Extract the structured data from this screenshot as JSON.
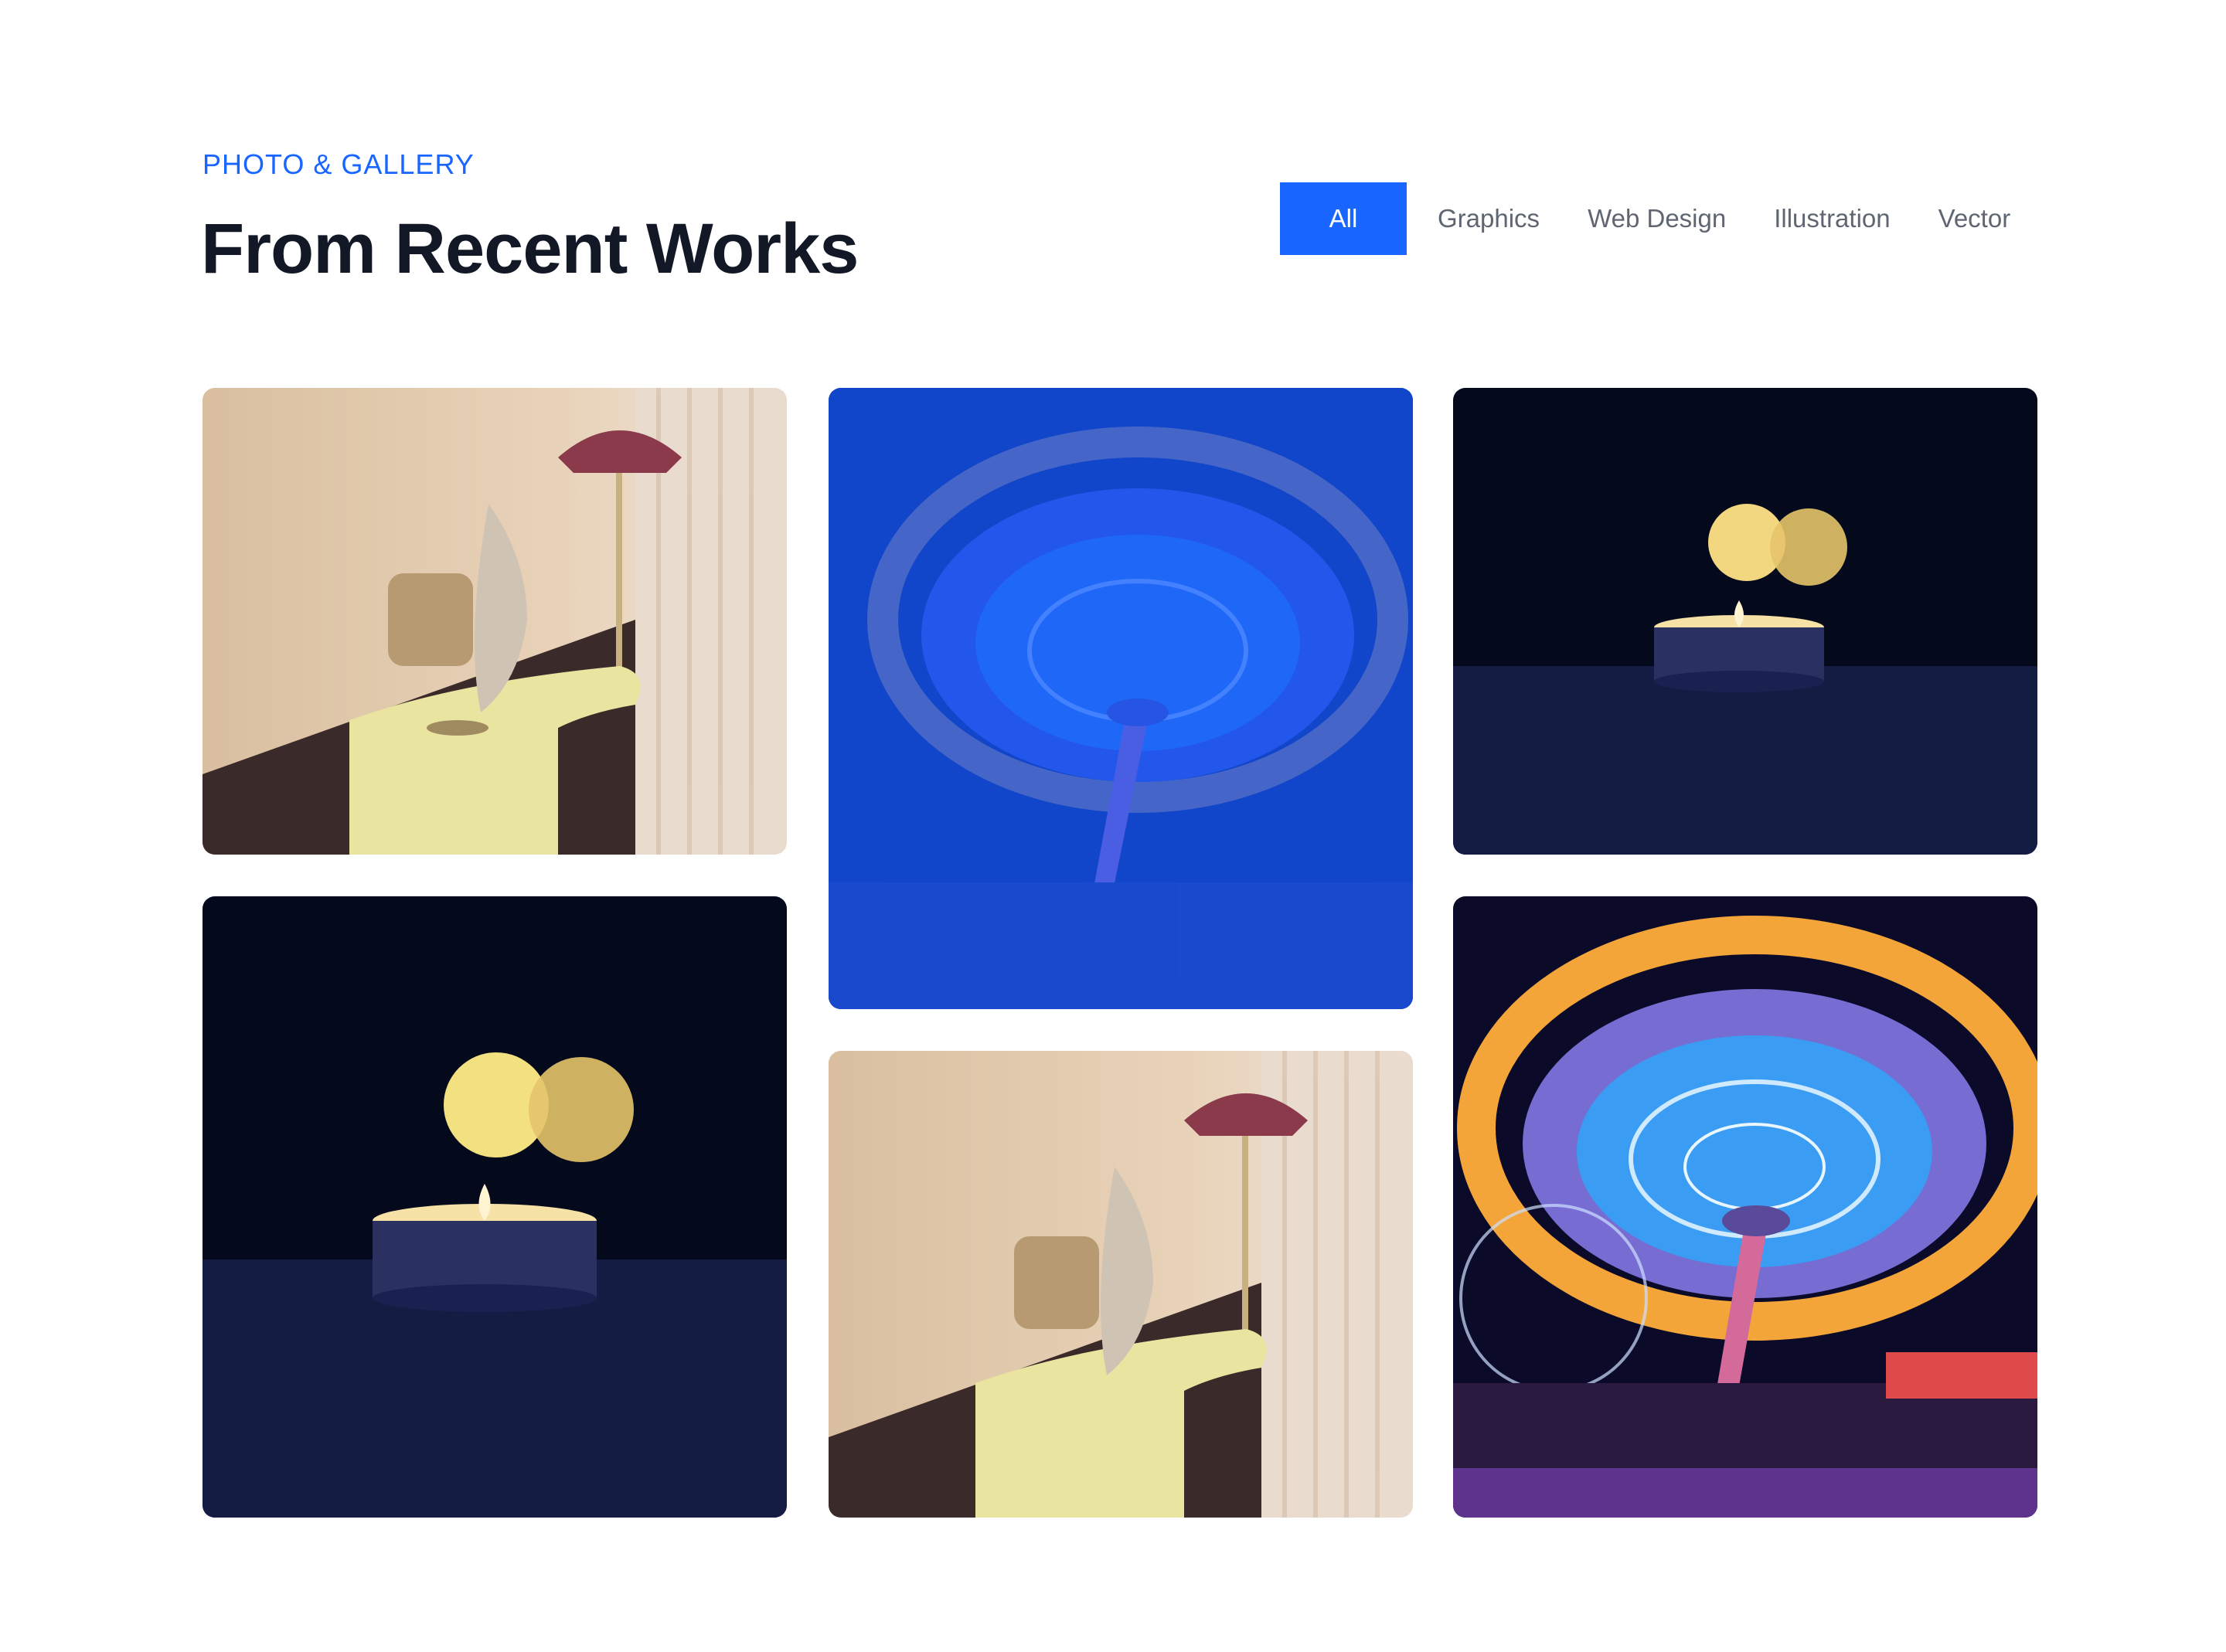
{
  "header": {
    "eyebrow": "PHOTO & GALLERY",
    "title": "From Recent Works"
  },
  "filters": [
    {
      "label": "All",
      "active": true
    },
    {
      "label": "Graphics",
      "active": false
    },
    {
      "label": "Web Design",
      "active": false
    },
    {
      "label": "Illustration",
      "active": false
    },
    {
      "label": "Vector",
      "active": false
    }
  ],
  "colors": {
    "accent": "#1866ff",
    "title": "#121826",
    "filter_text": "#5f6672"
  },
  "gallery": [
    {
      "subject": "lamp-table-photo",
      "hovered": false
    },
    {
      "subject": "carousel-photo",
      "hovered": true
    },
    {
      "subject": "candle-photo",
      "hovered": false
    },
    {
      "subject": "candle-photo",
      "hovered": false
    },
    {
      "subject": "lamp-table-photo",
      "hovered": false
    },
    {
      "subject": "carousel-photo",
      "hovered": false
    }
  ]
}
